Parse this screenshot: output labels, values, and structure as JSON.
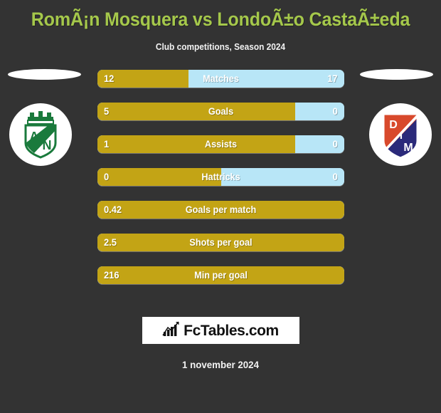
{
  "header": {
    "title": "RomÃ¡n Mosquera vs LondoÃ±o CastaÃ±eda",
    "subtitle": "Club competitions, Season 2024"
  },
  "teams": {
    "left": {
      "name": "Atletico Nacional",
      "crest_icon": "atletico-nacional-crest",
      "colors": {
        "primary": "#1a7a3c",
        "background": "#ffffff"
      }
    },
    "right": {
      "name": "Independiente Medellin",
      "crest_icon": "independiente-medellin-crest",
      "letters": [
        "D",
        "I",
        "M"
      ],
      "colors": {
        "primary": "#d8492c",
        "secondary": "#2b2a7a",
        "background": "#ffffff"
      }
    }
  },
  "colors": {
    "background": "#333333",
    "title": "#a5c84b",
    "left_bar": "#c3a415",
    "right_bar": "#b8e6f7",
    "text": "#ffffff"
  },
  "chart_data": {
    "type": "bar",
    "title": "RomÃ¡n Mosquera vs LondoÃ±o CastaÃ±eda",
    "subtitle": "Club competitions, Season 2024",
    "orientation": "horizontal-diverging",
    "legend": [
      "RomÃ¡n Mosquera",
      "LondoÃ±o CastaÃ±eda"
    ],
    "categories": [
      "Matches",
      "Goals",
      "Assists",
      "Hattricks",
      "Goals per match",
      "Shots per goal",
      "Min per goal"
    ],
    "series": [
      {
        "name": "RomÃ¡n Mosquera",
        "side": "left",
        "color": "#c3a415",
        "values": [
          "12",
          "5",
          "1",
          "0",
          "0.42",
          "2.5",
          "216"
        ]
      },
      {
        "name": "LondoÃ±o CastaÃ±eda",
        "side": "right",
        "color": "#b8e6f7",
        "values": [
          "17",
          "0",
          "0",
          "0",
          null,
          null,
          null
        ]
      }
    ],
    "rows": [
      {
        "label": "Matches",
        "left": "12",
        "right": "17",
        "left_pct": 37,
        "has_right": true
      },
      {
        "label": "Goals",
        "left": "5",
        "right": "0",
        "left_pct": 80,
        "has_right": true
      },
      {
        "label": "Assists",
        "left": "1",
        "right": "0",
        "left_pct": 80,
        "has_right": true
      },
      {
        "label": "Hattricks",
        "left": "0",
        "right": "0",
        "left_pct": 50,
        "has_right": true
      },
      {
        "label": "Goals per match",
        "left": "0.42",
        "right": "",
        "left_pct": 100,
        "has_right": false
      },
      {
        "label": "Shots per goal",
        "left": "2.5",
        "right": "",
        "left_pct": 100,
        "has_right": false
      },
      {
        "label": "Min per goal",
        "left": "216",
        "right": "",
        "left_pct": 100,
        "has_right": false
      }
    ]
  },
  "footer": {
    "brand_text": "FcTables.com",
    "brand_icon": "bar-chart-growth-icon",
    "date": "1 november 2024"
  }
}
